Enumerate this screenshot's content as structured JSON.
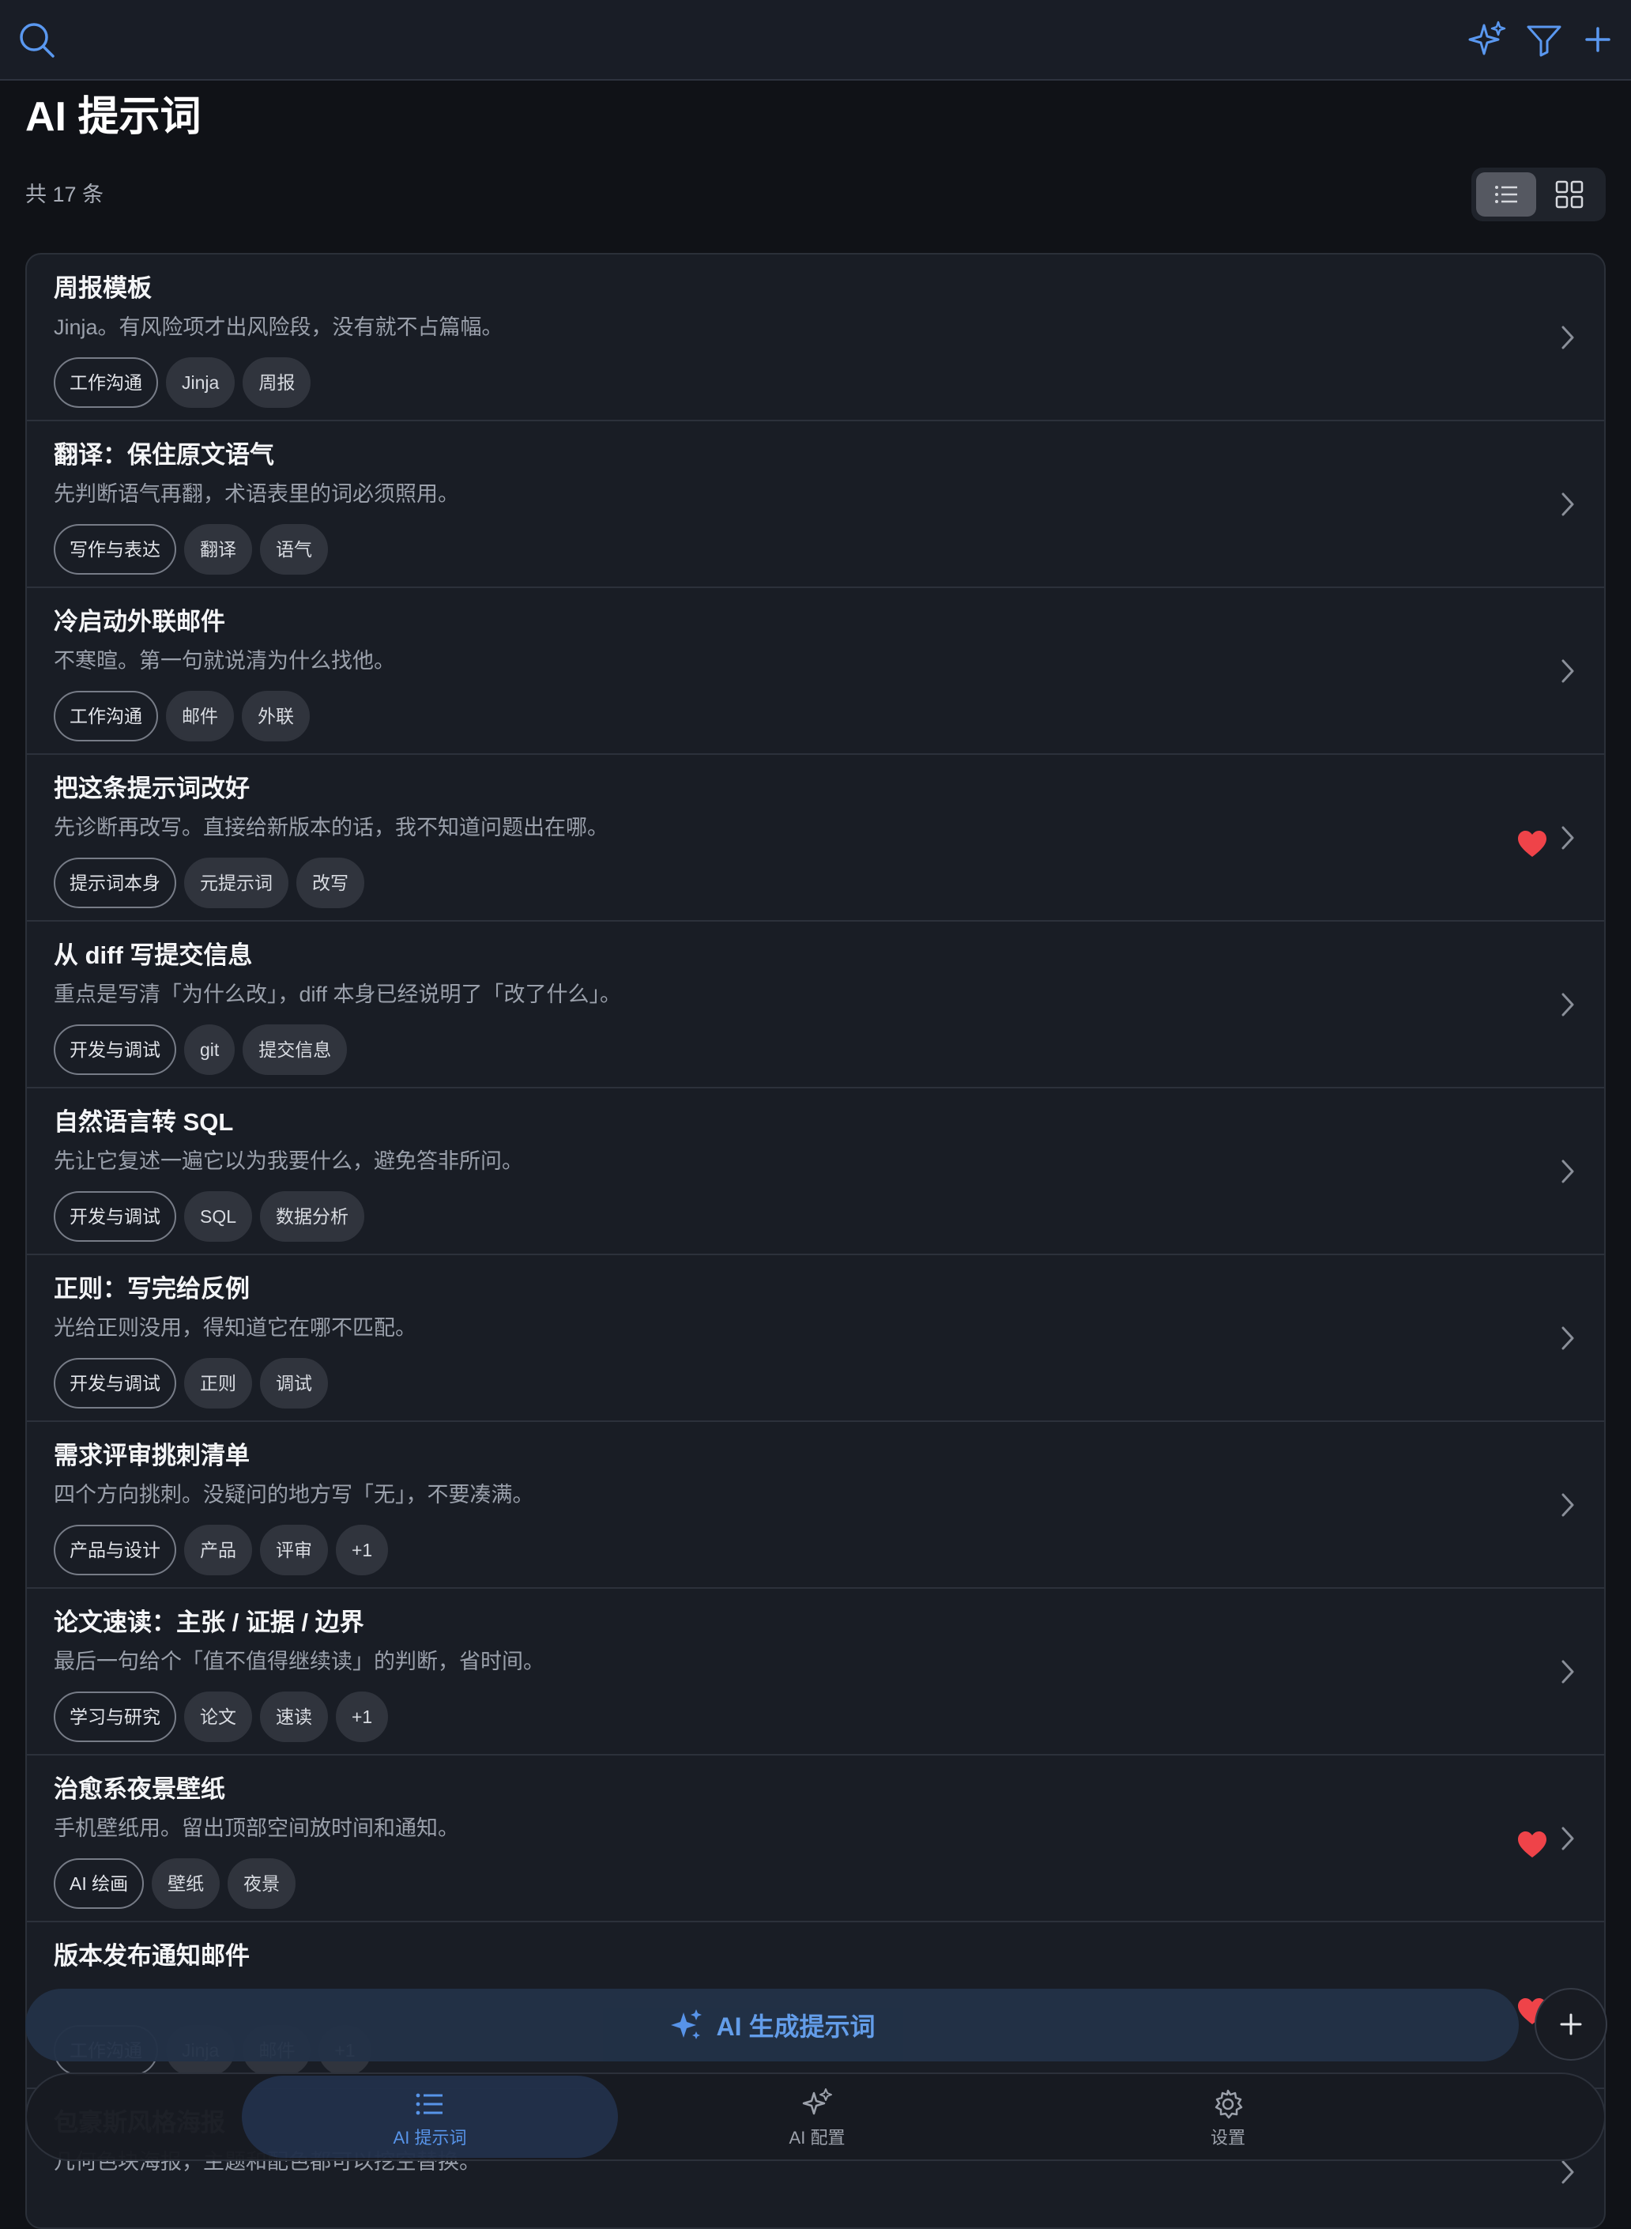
{
  "page": {
    "title": "AI 提示词",
    "count": "共 17 条"
  },
  "topbar": {
    "icons": [
      "search-icon",
      "sparkles-icon",
      "filter-icon",
      "plus-icon"
    ]
  },
  "view_toggle": {
    "active": "list",
    "options": [
      "list-view-icon",
      "grid-view-icon"
    ]
  },
  "items": [
    {
      "title": "周报模板",
      "desc": "Jinja。有风险项才出风险段，没有就不占篇幅。",
      "category": "工作沟通",
      "tags": [
        "Jinja",
        "周报"
      ],
      "favorite": false
    },
    {
      "title": "翻译：保住原文语气",
      "desc": "先判断语气再翻，术语表里的词必须照用。",
      "category": "写作与表达",
      "tags": [
        "翻译",
        "语气"
      ],
      "favorite": false
    },
    {
      "title": "冷启动外联邮件",
      "desc": "不寒暄。第一句就说清为什么找他。",
      "category": "工作沟通",
      "tags": [
        "邮件",
        "外联"
      ],
      "favorite": false
    },
    {
      "title": "把这条提示词改好",
      "desc": "先诊断再改写。直接给新版本的话，我不知道问题出在哪。",
      "category": "提示词本身",
      "tags": [
        "元提示词",
        "改写"
      ],
      "favorite": true
    },
    {
      "title": "从 diff 写提交信息",
      "desc": "重点是写清「为什么改」，diff 本身已经说明了「改了什么」。",
      "category": "开发与调试",
      "tags": [
        "git",
        "提交信息"
      ],
      "favorite": false
    },
    {
      "title": "自然语言转 SQL",
      "desc": "先让它复述一遍它以为我要什么，避免答非所问。",
      "category": "开发与调试",
      "tags": [
        "SQL",
        "数据分析"
      ],
      "favorite": false
    },
    {
      "title": "正则：写完给反例",
      "desc": "光给正则没用，得知道它在哪不匹配。",
      "category": "开发与调试",
      "tags": [
        "正则",
        "调试"
      ],
      "favorite": false
    },
    {
      "title": "需求评审挑刺清单",
      "desc": "四个方向挑刺。没疑问的地方写「无」，不要凑满。",
      "category": "产品与设计",
      "tags": [
        "产品",
        "评审",
        "+1"
      ],
      "favorite": false
    },
    {
      "title": "论文速读：主张 / 证据 / 边界",
      "desc": "最后一句给个「值不值得继续读」的判断，省时间。",
      "category": "学习与研究",
      "tags": [
        "论文",
        "速读",
        "+1"
      ],
      "favorite": false
    },
    {
      "title": "治愈系夜景壁纸",
      "desc": "手机壁纸用。留出顶部空间放时间和通知。",
      "category": "AI 绘画",
      "tags": [
        "壁纸",
        "夜景"
      ],
      "favorite": true
    },
    {
      "title": "版本发布通知邮件",
      "desc": "",
      "category": "工作沟通",
      "tags": [
        "Jinja",
        "邮件",
        "+1"
      ],
      "favorite": true
    },
    {
      "title": "包豪斯风格海报",
      "desc": "几何色块海报，主题和配色都可以挖空替换。",
      "category": "",
      "tags": [],
      "favorite": false
    }
  ],
  "ai_generate": {
    "label": "AI 生成提示词",
    "icon": "sparkles-icon"
  },
  "fab": {
    "icon": "plus-icon"
  },
  "tabbar": {
    "tabs": [
      {
        "label": "AI 提示词",
        "icon": "list-icon",
        "active": true
      },
      {
        "label": "AI 配置",
        "icon": "sparkles-icon",
        "active": false
      },
      {
        "label": "设置",
        "icon": "gear-icon",
        "active": false
      }
    ]
  },
  "colors": {
    "accent": "#5a98f0",
    "favorite": "#ef4349",
    "background": "#101217",
    "card": "#191d25"
  }
}
